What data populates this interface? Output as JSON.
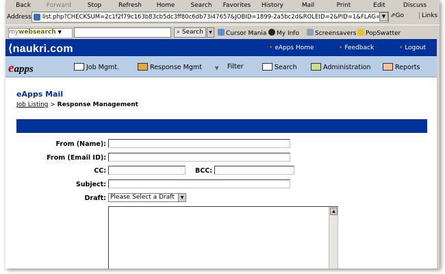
{
  "browser": {
    "buttons": [
      "Back",
      "Forward",
      "Stop",
      "Refresh",
      "Home",
      "Search",
      "Favorites",
      "History",
      "Mail",
      "Print",
      "Edit",
      "Discuss"
    ],
    "address_label": "Address",
    "address_value": "list.php?CHECKSUM=2c1f2f79c163b83cb5dc3ff80c6db73i47657&JOBID=1899-2a5bc2d&ROLEID=2&PID=1&FLAG=listbyrole",
    "go_label": "Go",
    "links_label": "Links"
  },
  "searchbar": {
    "brand_prefix": "my",
    "brand_main": "websearch",
    "search_button": "Search",
    "items": [
      "Cursor Mania",
      "My Info",
      "Screensavers",
      "PopSwatter"
    ]
  },
  "site": {
    "logo": "naukri.com",
    "top_links": [
      "eApps Home",
      "Feedback",
      "Logout"
    ],
    "eapps_logo": "apps",
    "eapps_e": "e",
    "menu": [
      "Job Mgmt.",
      "Response Mgmt",
      "Filter",
      "Search",
      "Administration",
      "Reports"
    ]
  },
  "content": {
    "title": "eApps Mail",
    "breadcrumb_link": "Job Listing",
    "breadcrumb_sep": " > ",
    "breadcrumb_current": "Response Management"
  },
  "form": {
    "from_name_label": "From (Name):",
    "from_email_label": "From (Email ID):",
    "cc_label": "CC:",
    "bcc_label": "BCC:",
    "subject_label": "Subject:",
    "draft_label": "Draft:",
    "draft_selected": "Please Select a Draft",
    "from_name_value": "",
    "from_email_value": "",
    "cc_value": "",
    "bcc_value": "",
    "subject_value": ""
  },
  "colors": {
    "brand_blue": "#003399",
    "menu_bg": "#b8cde6",
    "link_bullet": "#ff6600"
  }
}
